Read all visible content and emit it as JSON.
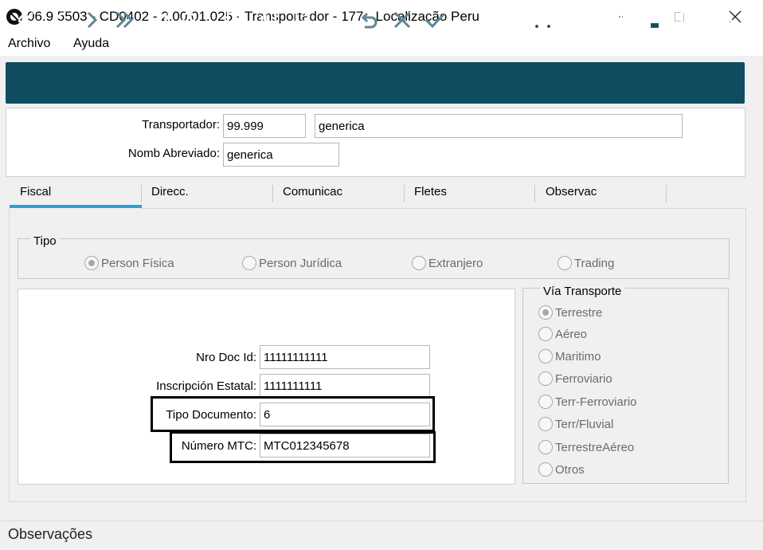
{
  "window": {
    "title": "06.9.5503 - CD0402 - 2.00.01.025 - Transportador - 177 - Localização Peru"
  },
  "menu": {
    "archivo": "Archivo",
    "ayuda": "Ayuda"
  },
  "toolbar": {
    "icons": [
      "first-icon",
      "previous-icon",
      "next-icon",
      "last-icon",
      "goto-icon",
      "search-icon",
      "new-icon",
      "copy-icon",
      "edit-icon",
      "delete-icon",
      "undo-icon",
      "cancel-icon",
      "confirm-icon",
      "truck-icon",
      "user-icon",
      "tree-icon",
      "print-icon",
      "exit-icon",
      "help-icon"
    ],
    "background": "#0f4c60"
  },
  "header": {
    "transportador_label": "Transportador:",
    "transportador_code": "99.999",
    "transportador_name": "generica",
    "nomb_abreviado_label": "Nomb Abreviado:",
    "nomb_abreviado_value": "generica"
  },
  "tabs": [
    {
      "label": "Fiscal",
      "active": true
    },
    {
      "label": "Direcc.",
      "active": false
    },
    {
      "label": "Comunicac",
      "active": false
    },
    {
      "label": "Fletes",
      "active": false
    },
    {
      "label": "Observac",
      "active": false
    }
  ],
  "tipo": {
    "title": "Tipo",
    "options": [
      {
        "label": "Person Física",
        "checked": true
      },
      {
        "label": "Person Jurídica",
        "checked": false
      },
      {
        "label": "Extranjero",
        "checked": false
      },
      {
        "label": "Trading",
        "checked": false
      }
    ]
  },
  "fiscal": {
    "nro_doc_label": "Nro Doc Id:",
    "nro_doc_value": "11111111111",
    "inscripcion_label": "Inscripción Estatal:",
    "inscripcion_value": "1111111111",
    "tipo_doc_label": "Tipo Documento:",
    "tipo_doc_value": "6",
    "numero_mtc_label": "Número MTC:",
    "numero_mtc_value": "MTC012345678"
  },
  "via_transporte": {
    "title": "Vía Transporte",
    "options": [
      {
        "label": "Terrestre",
        "checked": true
      },
      {
        "label": "Aéreo",
        "checked": false
      },
      {
        "label": "Maritimo",
        "checked": false
      },
      {
        "label": "Ferroviario",
        "checked": false
      },
      {
        "label": "Terr-Ferroviario",
        "checked": false
      },
      {
        "label": "Terr/Fluvial",
        "checked": false
      },
      {
        "label": "TerrestreAéreo",
        "checked": false
      },
      {
        "label": "Otros",
        "checked": false
      }
    ]
  },
  "status": {
    "text": "Observações"
  },
  "colors": {
    "accent_tab": "#2a9fd8"
  }
}
